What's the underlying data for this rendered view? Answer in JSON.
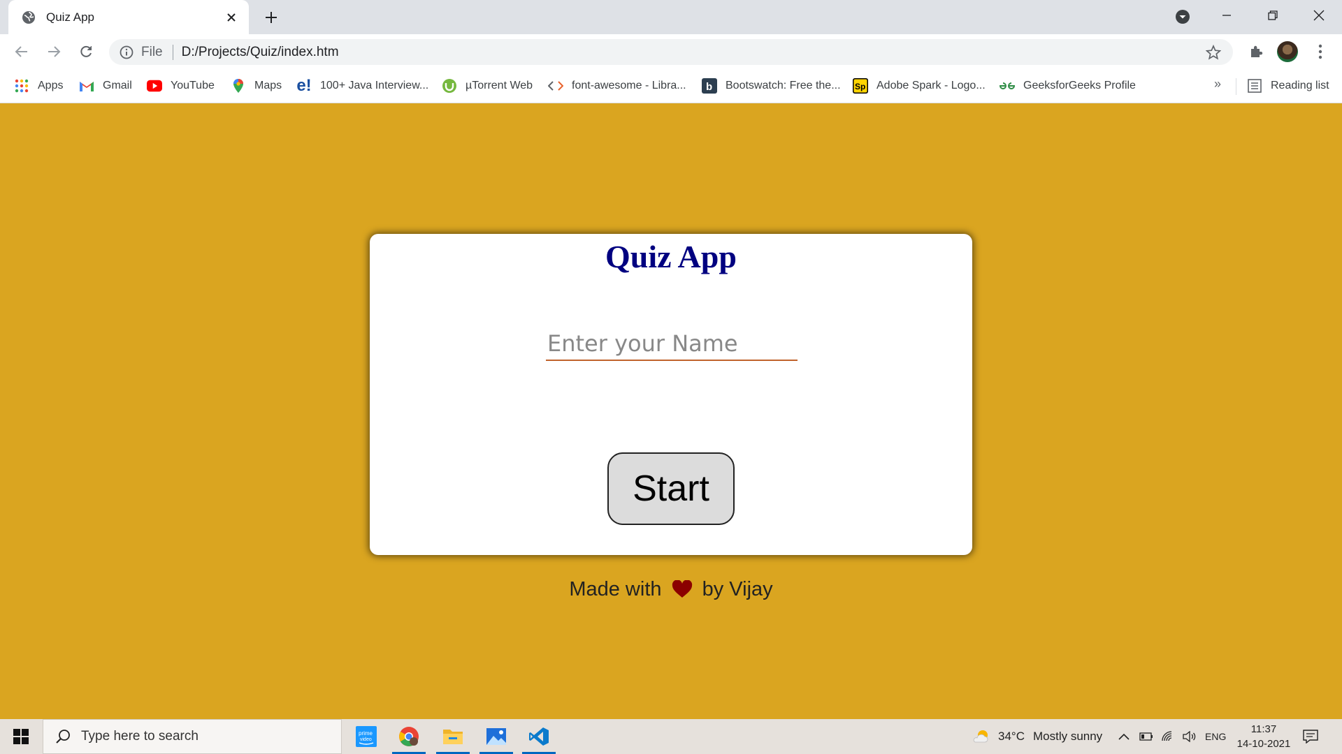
{
  "browser": {
    "tab_title": "Quiz App",
    "omnibox_scheme": "File",
    "url": "D:/Projects/Quiz/index.htm",
    "bookmarks": [
      {
        "label": "Apps",
        "icon": "apps-grid-icon"
      },
      {
        "label": "Gmail",
        "icon": "gmail-icon"
      },
      {
        "label": "YouTube",
        "icon": "youtube-icon"
      },
      {
        "label": "Maps",
        "icon": "maps-icon"
      },
      {
        "label": "100+ Java Interview...",
        "icon": "e-icon"
      },
      {
        "label": "µTorrent Web",
        "icon": "utorrent-icon"
      },
      {
        "label": "font-awesome - Libra...",
        "icon": "code-icon"
      },
      {
        "label": "Bootswatch: Free the...",
        "icon": "bootswatch-icon"
      },
      {
        "label": "Adobe Spark - Logo...",
        "icon": "adobe-spark-icon"
      },
      {
        "label": "GeeksforGeeks Profile",
        "icon": "gfg-icon"
      }
    ],
    "bookmarks_more": "»",
    "reading_list": "Reading list"
  },
  "page": {
    "title": "Quiz App",
    "name_placeholder": "Enter your Name",
    "name_value": "",
    "start_label": "Start",
    "footer_prefix": "Made with",
    "footer_suffix": "by Vijay"
  },
  "taskbar": {
    "search_placeholder": "Type here to search",
    "weather_temp": "34°C",
    "weather_text": "Mostly sunny",
    "language": "ENG",
    "time": "11:37",
    "date": "14-10-2021"
  },
  "colors": {
    "page_background": "#daa520",
    "title": "#000080",
    "input_underline": "#c0632b",
    "heart": "#8b0000"
  }
}
